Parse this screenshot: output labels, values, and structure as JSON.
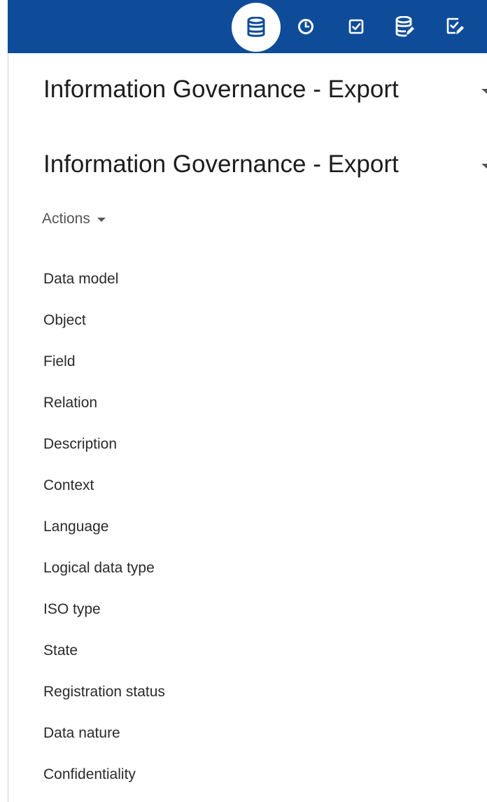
{
  "topbar": {
    "background": "#0e4c9a",
    "icons": [
      {
        "name": "database-icon",
        "active": true
      },
      {
        "name": "clock-icon",
        "active": false
      },
      {
        "name": "checkbox-icon",
        "active": false
      },
      {
        "name": "database-edit-icon",
        "active": false
      },
      {
        "name": "checkbox-edit-icon",
        "active": false
      }
    ]
  },
  "header": {
    "title": "Information Governance - Export"
  },
  "section": {
    "title": "Information Governance - Export"
  },
  "actions": {
    "label": "Actions"
  },
  "fields": [
    "Data model",
    "Object",
    "Field",
    "Relation",
    "Description",
    "Context",
    "Language",
    "Logical data type",
    "ISO type",
    "State",
    "Registration status",
    "Data nature",
    "Confidentiality"
  ]
}
